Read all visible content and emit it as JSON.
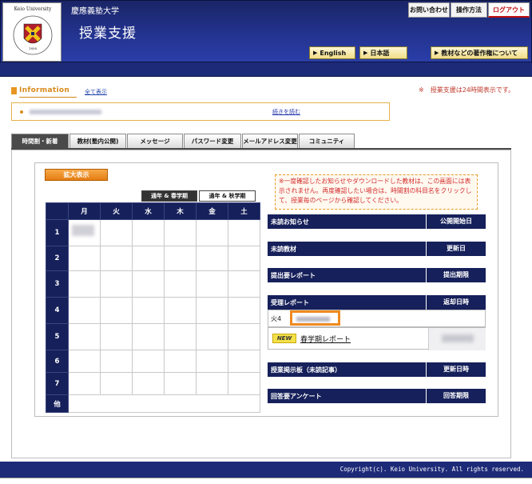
{
  "header": {
    "logo_text": "Keio University",
    "university": "慶應義塾大学",
    "title": "授業支援",
    "top_buttons": [
      "お問い合わせ",
      "操作方法",
      "ログアウト"
    ],
    "lang_buttons": [
      "English",
      "日本語"
    ],
    "copyright_button": "教材などの著作権について"
  },
  "info": {
    "heading": "Information",
    "show_all": "全て表示",
    "notice": "※　授業支援は24時間表示です。",
    "read_more": "続きを読む"
  },
  "tabs": [
    "時間割・新着",
    "教材(塾内公開)",
    "メッセージ",
    "パスワード変更",
    "メールアドレス変更",
    "コミュニティ"
  ],
  "timetable": {
    "zoom_button": "拡大表示",
    "semester_tabs": [
      "通年 & 春学期",
      "通年 & 秋学期"
    ],
    "days": [
      "月",
      "火",
      "水",
      "木",
      "金",
      "土"
    ],
    "periods": [
      "1",
      "2",
      "3",
      "4",
      "5",
      "6",
      "7",
      "他"
    ]
  },
  "notice_box": "※一度確認したお知らせやダウンロードした教材は、この画面には表示されません。再度確認したい場合は、時間割の科目名をクリックして、授業毎のページから確認してください。",
  "sections": [
    {
      "label": "未読お知らせ",
      "right": "公開開始日"
    },
    {
      "label": "未読教材",
      "right": "更新日"
    },
    {
      "label": "提出要レポート",
      "right": "提出期限"
    },
    {
      "label": "受理レポート",
      "right": "返却日時"
    },
    {
      "label": "授業掲示板（未読記事）",
      "right": "更新日時"
    },
    {
      "label": "回答要アンケート",
      "right": "回答期限"
    }
  ],
  "received_report": {
    "period": "火4",
    "new_badge": "NEW",
    "report_link": "春学期レポート"
  },
  "footer": "Copyright(c). Keio University. All rights reserved."
}
